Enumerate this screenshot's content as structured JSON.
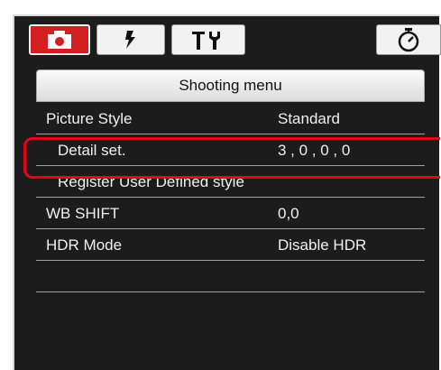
{
  "tabs": [
    {
      "id": "camera",
      "icon": "camera-icon",
      "active": true
    },
    {
      "id": "flash",
      "icon": "flash-icon",
      "active": false
    },
    {
      "id": "tools",
      "icon": "tools-icon",
      "active": false
    },
    {
      "id": "timer",
      "icon": "timer-icon",
      "active": false
    }
  ],
  "menu": {
    "title": "Shooting menu",
    "rows": [
      {
        "label": "Picture Style",
        "value": "Standard"
      },
      {
        "label": "Detail set.",
        "value": "3 , 0 , 0 , 0"
      },
      {
        "label": "Register User Defined style",
        "value": ""
      },
      {
        "label": "WB SHIFT",
        "value": "0,0"
      },
      {
        "label": "HDR Mode",
        "value": "Disable HDR"
      },
      {
        "label": "",
        "value": ""
      },
      {
        "label": "",
        "value": ""
      }
    ]
  },
  "colors": {
    "background": "#1c1c1c",
    "accent_red": "#d21f1f",
    "highlight_border": "#e5001c",
    "text": "#f0f0f0"
  }
}
